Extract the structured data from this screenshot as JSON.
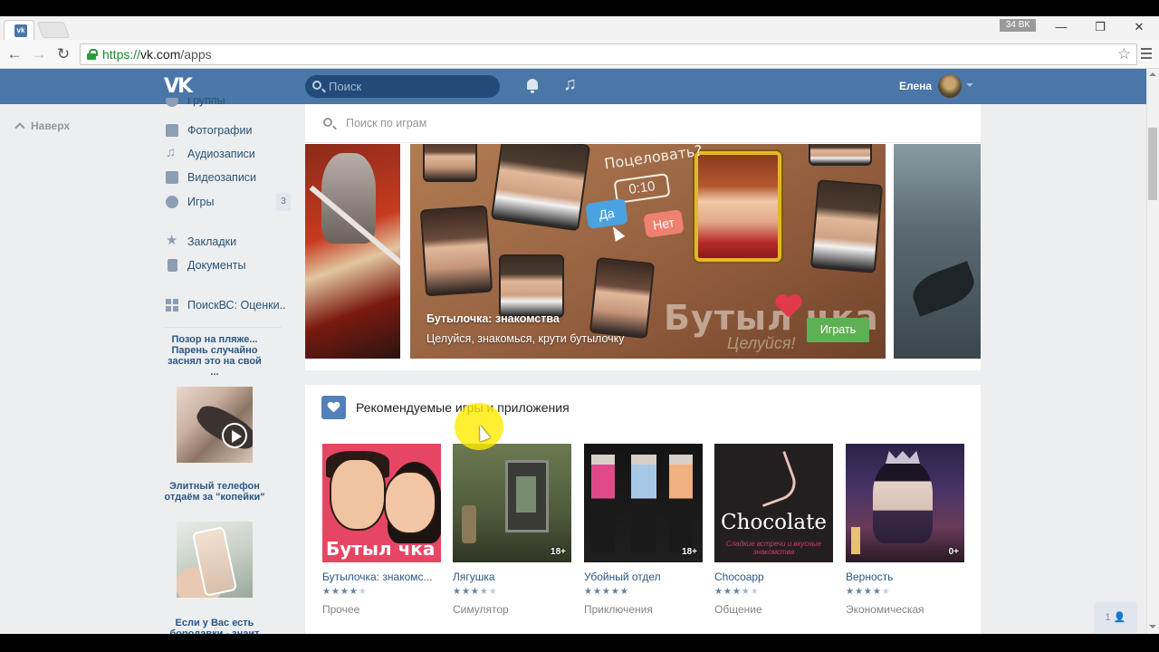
{
  "browser": {
    "tab_favicon": "vk-icon",
    "badge": "34 ВК",
    "url_host": "https://",
    "url_main": "vk.com",
    "url_path": "/apps",
    "win_minimize": "—",
    "win_restore": "❐",
    "win_close": "✕",
    "back": "←",
    "forward": "→",
    "reload": "↻",
    "bookmark": "☆"
  },
  "header": {
    "logo": "VK",
    "search_placeholder": "Поиск",
    "username": "Елена",
    "note_glyph": "♫"
  },
  "sidebar": {
    "up_link": "Наверх",
    "items": [
      {
        "label": "Группы",
        "icon": "users-icon"
      },
      {
        "label": "Фотографии",
        "icon": "camera-icon"
      },
      {
        "label": "Аудиозаписи",
        "icon": "music-icon"
      },
      {
        "label": "Видеозаписи",
        "icon": "video-icon"
      },
      {
        "label": "Игры",
        "icon": "gamepad-icon",
        "count": "3"
      },
      {
        "label": "Закладки",
        "icon": "star-icon"
      },
      {
        "label": "Документы",
        "icon": "document-icon"
      },
      {
        "label": "ПоискВС: Оценки..",
        "icon": "app-grid-icon"
      }
    ],
    "ads": [
      {
        "title": "Позор на пляже... Парень случайно заснял это на свой ..."
      },
      {
        "title": "Элитный телефон отдаём за \"копейки\""
      },
      {
        "title": "Если у Вас есть бородавки - знаит"
      }
    ]
  },
  "games": {
    "search_placeholder": "Поиск по играм",
    "featured": {
      "title": "Бутылочка: знакомства",
      "description": "Целуйся, знакомься, крути бутылочку",
      "play_label": "Играть",
      "art_question": "Поцеловать?",
      "art_timer": "0:10",
      "art_yes": "Да",
      "art_no": "Нет",
      "art_brand": "Бутыл   чка",
      "art_slogan": "Целуйся!"
    },
    "recommended": {
      "title": "Рекомендуемые игры и приложения",
      "apps": [
        {
          "name": "Бутылочка: знакомс...",
          "category": "Прочее",
          "rating": 4,
          "thumb_text": "Бутыл чка",
          "age": ""
        },
        {
          "name": "Лягушка",
          "category": "Симулятор",
          "rating": 3.5,
          "age": "18+"
        },
        {
          "name": "Убойный отдел",
          "category": "Приключения",
          "rating": 5,
          "age": "18+"
        },
        {
          "name": "Chocoapp",
          "category": "Общение",
          "rating": 3.5,
          "thumb_text": "Chocolate",
          "thumb_sub": "Сладкие встречи и вкусные знакомства",
          "age": ""
        },
        {
          "name": "Верность",
          "category": "Экономическая",
          "rating": 4,
          "age": "0+"
        }
      ]
    }
  },
  "friends_button": "1",
  "colors": {
    "vk_blue": "#4a76a8",
    "link": "#2a5885",
    "play_green": "#5fb053",
    "page_bg": "#edeef0"
  }
}
